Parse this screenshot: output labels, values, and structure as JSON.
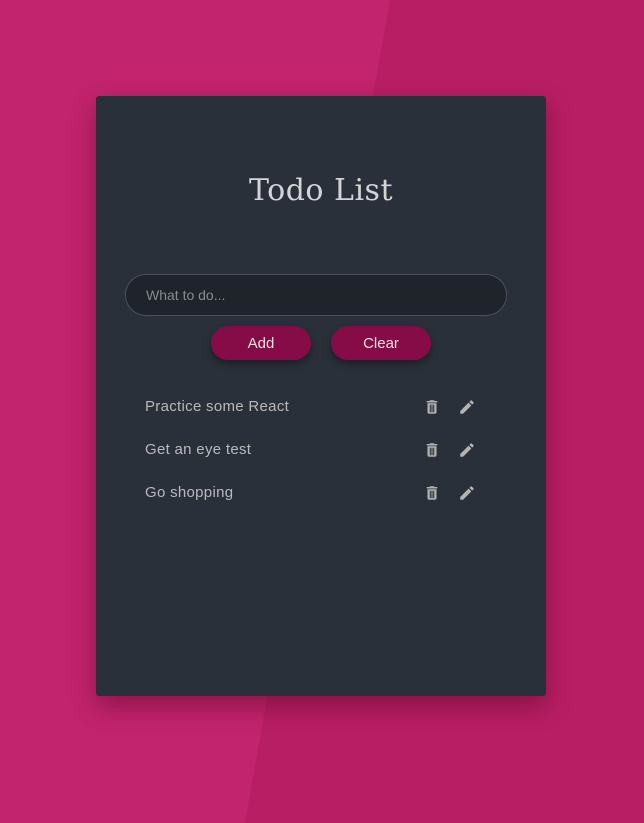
{
  "app": {
    "title": "Todo List"
  },
  "input": {
    "placeholder": "What to do...",
    "value": ""
  },
  "buttons": {
    "add_label": "Add",
    "clear_label": "Clear"
  },
  "todos": [
    {
      "text": "Practice some React"
    },
    {
      "text": "Get an eye test"
    },
    {
      "text": "Go shopping"
    }
  ],
  "icons": {
    "delete": "trash-icon",
    "edit": "pencil-icon"
  },
  "colors": {
    "background": "#b81e64",
    "card": "#2a3039",
    "button": "#850c46",
    "text": "#b9b9b9"
  }
}
